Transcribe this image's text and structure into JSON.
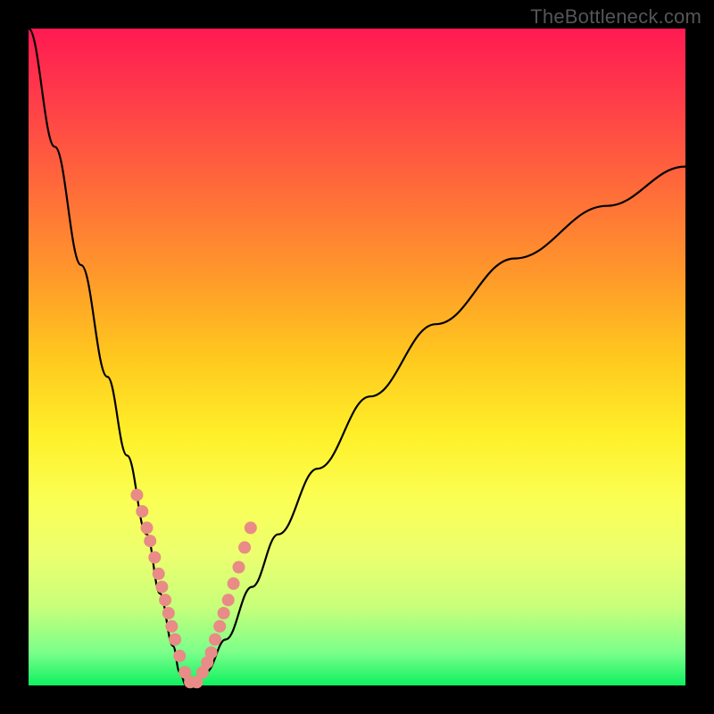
{
  "attribution": "TheBottleneck.com",
  "colors": {
    "frame": "#000000",
    "curve": "#000000",
    "dot_fill": "#e98b86",
    "dot_stroke": "#d87670",
    "gradient_top": "#ff1a52",
    "gradient_bottom": "#10f060"
  },
  "chart_data": {
    "type": "line",
    "title": "",
    "xlabel": "",
    "ylabel": "",
    "xlim": [
      0,
      100
    ],
    "ylim": [
      0,
      100
    ],
    "note": "Axes are unlabeled; values are normalized 0–100 estimated from pixel positions. y=0 is the green bottom, y=100 is the red top. The curve is a V reaching y≈0 near x≈24.",
    "series": [
      {
        "name": "bottleneck-curve",
        "x": [
          0,
          4,
          8,
          12,
          15,
          18,
          20,
          22,
          23,
          24,
          25,
          27,
          30,
          34,
          38,
          44,
          52,
          62,
          74,
          88,
          100
        ],
        "y": [
          100,
          82,
          64,
          47,
          35,
          23,
          14,
          6,
          2,
          0,
          0,
          2,
          7,
          15,
          23,
          33,
          44,
          55,
          65,
          73,
          79
        ]
      }
    ],
    "scatter_points": {
      "name": "highlighted-points",
      "note": "Pink dots overlaid on the curve on both sides of the minimum, estimated positions.",
      "x": [
        16.5,
        17.3,
        18.0,
        18.5,
        19.2,
        19.8,
        20.3,
        20.8,
        21.3,
        21.8,
        22.3,
        23.0,
        23.8,
        24.6,
        25.6,
        26.5,
        27.2,
        27.8,
        28.4,
        29.1,
        29.7,
        30.4,
        31.2,
        32.0,
        32.9,
        33.8
      ],
      "y": [
        29,
        26.5,
        24,
        22,
        19.5,
        17,
        15,
        13,
        11,
        9,
        7,
        4.5,
        2,
        0.5,
        0.5,
        2,
        3.5,
        5,
        7,
        9,
        11,
        13,
        15.5,
        18,
        21,
        24
      ]
    }
  }
}
